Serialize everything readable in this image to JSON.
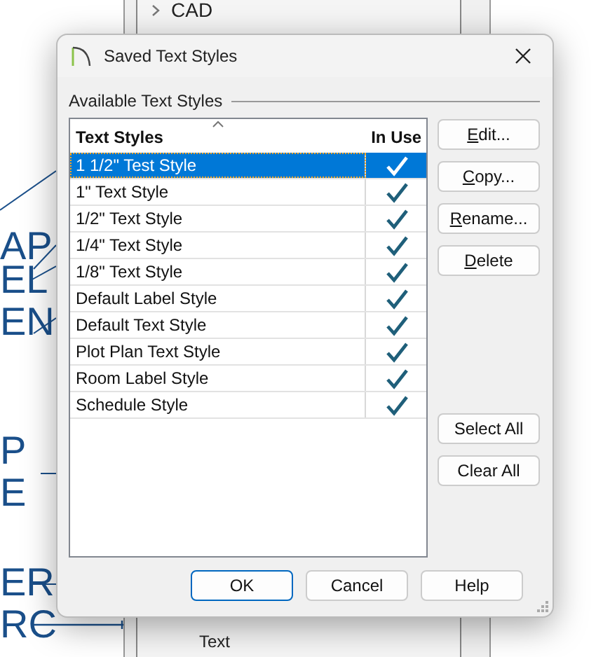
{
  "background": {
    "tree_items": [
      {
        "label": "CAD"
      }
    ],
    "bottom_item": "Text",
    "drawing_labels": [
      {
        "text": "AP"
      },
      {
        "text": "EL"
      },
      {
        "text": "EN"
      },
      {
        "text": "P"
      },
      {
        "text": "E"
      },
      {
        "text": "ER"
      },
      {
        "text": "RC"
      }
    ]
  },
  "dialog": {
    "title": "Saved Text Styles",
    "group_label": "Available Text Styles",
    "columns": [
      "Text Styles",
      "In Use"
    ],
    "rows": [
      {
        "name": "1 1/2\" Test Style",
        "in_use": true,
        "selected": true
      },
      {
        "name": "1\" Text Style",
        "in_use": true,
        "selected": false
      },
      {
        "name": "1/2\" Text Style",
        "in_use": true,
        "selected": false
      },
      {
        "name": "1/4\" Text Style",
        "in_use": true,
        "selected": false
      },
      {
        "name": "1/8\" Text Style",
        "in_use": true,
        "selected": false
      },
      {
        "name": "Default Label Style",
        "in_use": true,
        "selected": false
      },
      {
        "name": "Default Text Style",
        "in_use": true,
        "selected": false
      },
      {
        "name": "Plot Plan Text Style",
        "in_use": true,
        "selected": false
      },
      {
        "name": "Room Label Style",
        "in_use": true,
        "selected": false
      },
      {
        "name": "Schedule Style",
        "in_use": true,
        "selected": false
      }
    ],
    "side_buttons": [
      {
        "label": "Edit...",
        "mnemonic": true
      },
      {
        "label": "Copy...",
        "mnemonic": true
      },
      {
        "label": "Rename...",
        "mnemonic": true
      },
      {
        "label": "Delete",
        "mnemonic": true
      }
    ],
    "selection_buttons": [
      {
        "label": "Select All"
      },
      {
        "label": "Clear All"
      }
    ],
    "footer_buttons": [
      {
        "label": "OK",
        "default": true
      },
      {
        "label": "Cancel",
        "default": false
      },
      {
        "label": "Help",
        "default": false
      }
    ]
  }
}
